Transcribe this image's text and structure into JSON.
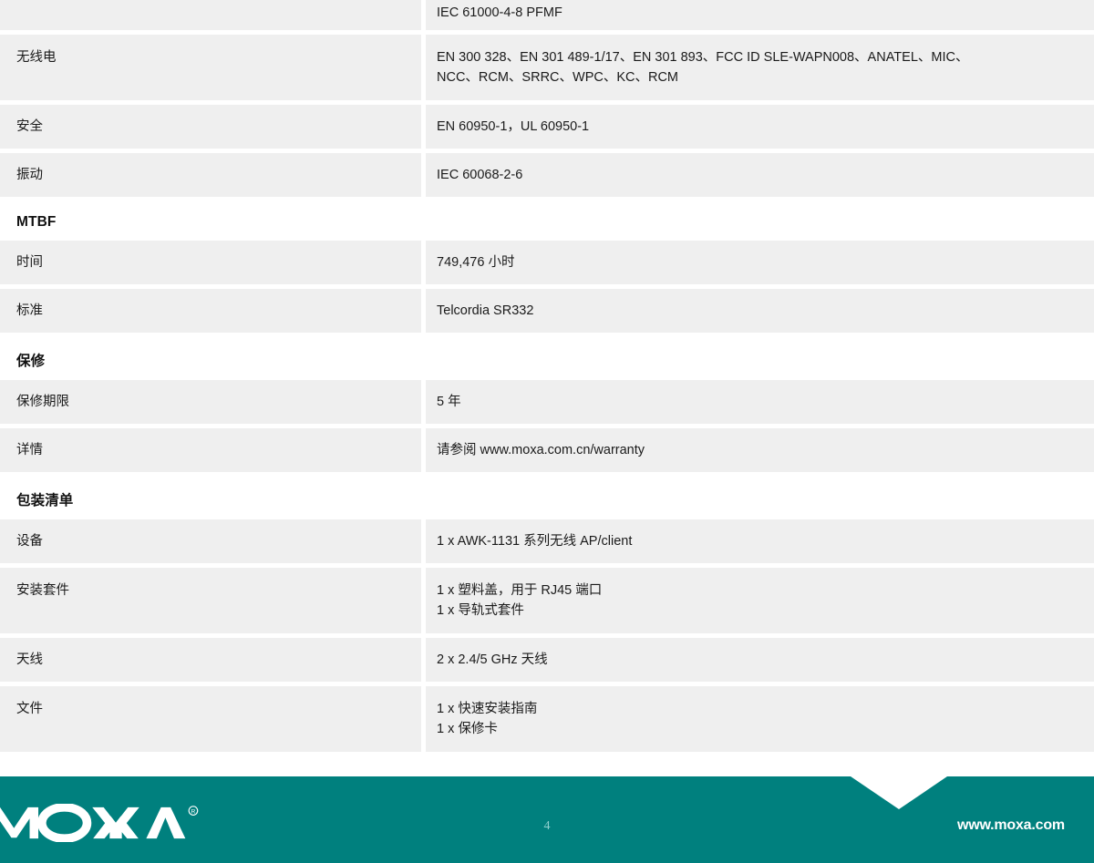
{
  "page": {
    "number": "4",
    "url": "www.moxa.com",
    "brand": "MOXA",
    "brand_trademark": "®",
    "accent_color": "#00807e",
    "row_background": "#efefef",
    "page_number_color": "#8ecfce"
  },
  "top_partial_row": {
    "label": "",
    "value": "IEC 61000-4-8 PFMF"
  },
  "sections": [
    {
      "heading": null,
      "rows": [
        {
          "label": "无线电",
          "value": "EN 300 328、EN 301 489-1/17、EN 301 893、FCC ID SLE-WAPN008、ANATEL、MIC、\nNCC、RCM、SRRC、WPC、KC、RCM"
        },
        {
          "label": "安全",
          "value": "EN 60950-1，UL 60950-1"
        },
        {
          "label": "振动",
          "value": "IEC 60068-2-6"
        }
      ]
    },
    {
      "heading": "MTBF",
      "rows": [
        {
          "label": "时间",
          "value": "749,476 小时"
        },
        {
          "label": "标准",
          "value": "Telcordia SR332"
        }
      ]
    },
    {
      "heading": "保修",
      "rows": [
        {
          "label": "保修期限",
          "value": "5 年"
        },
        {
          "label": "详情",
          "value": "请参阅 www.moxa.com.cn/warranty"
        }
      ]
    },
    {
      "heading": "包装清单",
      "rows": [
        {
          "label": "设备",
          "value": "1 x AWK-1131 系列无线 AP/client"
        },
        {
          "label": "安装套件",
          "value": "1 x 塑料盖，用于 RJ45 端口\n1 x 导轨式套件"
        },
        {
          "label": "天线",
          "value": "2 x 2.4/5 GHz 天线"
        },
        {
          "label": "文件",
          "value": "1 x 快速安装指南\n1 x 保修卡"
        }
      ]
    }
  ]
}
